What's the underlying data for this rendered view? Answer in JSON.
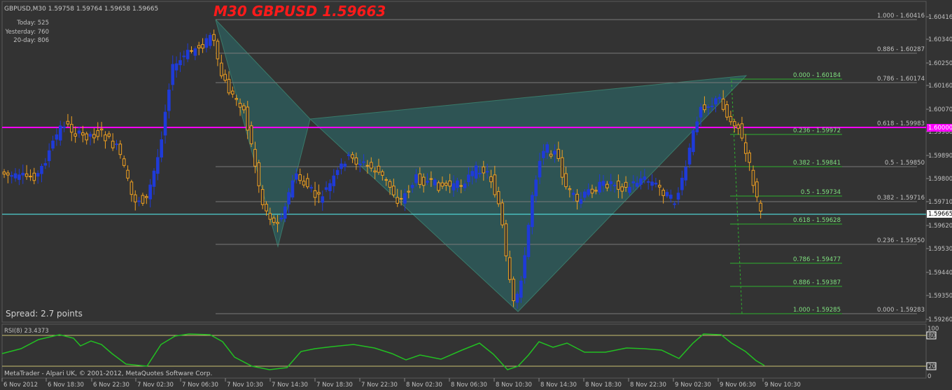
{
  "header": {
    "symbol_line": "GBPUSD,M30  1.59758 1.59764 1.59658 1.59665",
    "big_title": "M30 GBPUSD 1.59663",
    "today": "Today: 525",
    "yesterday": "Yesterday: 760",
    "twenty_day": "20-day: 806"
  },
  "spread": "Spread: 2.7 points",
  "price_axis": {
    "ticks": [
      "1.60416",
      "1.60340",
      "1.60250",
      "1.60160",
      "1.60070",
      "1.59980",
      "1.59890",
      "1.59800",
      "1.59710",
      "1.59620",
      "1.59530",
      "1.59440",
      "1.59350",
      "1.59260"
    ],
    "current_price_label": "1.59665",
    "level_label": "1.60000"
  },
  "fib_right": [
    {
      "label": "1.000 - 1.60416"
    },
    {
      "label": "0.886 - 1.60287"
    },
    {
      "label": "0.786 - 1.60174"
    },
    {
      "label": "0.618 - 1.59983"
    },
    {
      "label": "0.5 - 1.59850"
    },
    {
      "label": "0.382 - 1.59716"
    },
    {
      "label": "0.236 - 1.59550"
    },
    {
      "label": "0.000 - 1.59283"
    }
  ],
  "fib_green": [
    {
      "label": "0.000 - 1.60184"
    },
    {
      "label": "0.236 - 1.59972"
    },
    {
      "label": "0.382 - 1.59841"
    },
    {
      "label": "0.5 - 1.59734"
    },
    {
      "label": "0.618 - 1.59628"
    },
    {
      "label": "0.786 - 1.59477"
    },
    {
      "label": "0.886 - 1.59387"
    },
    {
      "label": "1.000 - 1.59285"
    }
  ],
  "rsi": {
    "label": "RSI(8) 23.4373",
    "axis_top": "100",
    "level_high": "80",
    "level_low": "20",
    "axis_bottom": "0"
  },
  "copyright": "MetaTrader - Alpari UK, © 2001-2012, MetaQuotes Software Corp.",
  "time_axis": [
    "6 Nov 2012",
    "6 Nov 18:30",
    "6 Nov 22:30",
    "7 Nov 02:30",
    "7 Nov 06:30",
    "7 Nov 10:30",
    "7 Nov 14:30",
    "7 Nov 18:30",
    "7 Nov 22:30",
    "8 Nov 02:30",
    "8 Nov 06:30",
    "8 Nov 10:30",
    "8 Nov 14:30",
    "8 Nov 18:30",
    "8 Nov 22:30",
    "9 Nov 02:30",
    "9 Nov 06:30",
    "9 Nov 10:30"
  ],
  "colors": {
    "background": "#333333",
    "bull": "#1f3bd8",
    "bear": "#f0a020",
    "pattern": "#2e5a5a",
    "level_magenta": "#ff00ff",
    "level_cyan": "#4fd0d0",
    "fib_grey": "#8c8c8c",
    "fib_green": "#2fb02f",
    "rsi_line": "#22c022"
  }
}
